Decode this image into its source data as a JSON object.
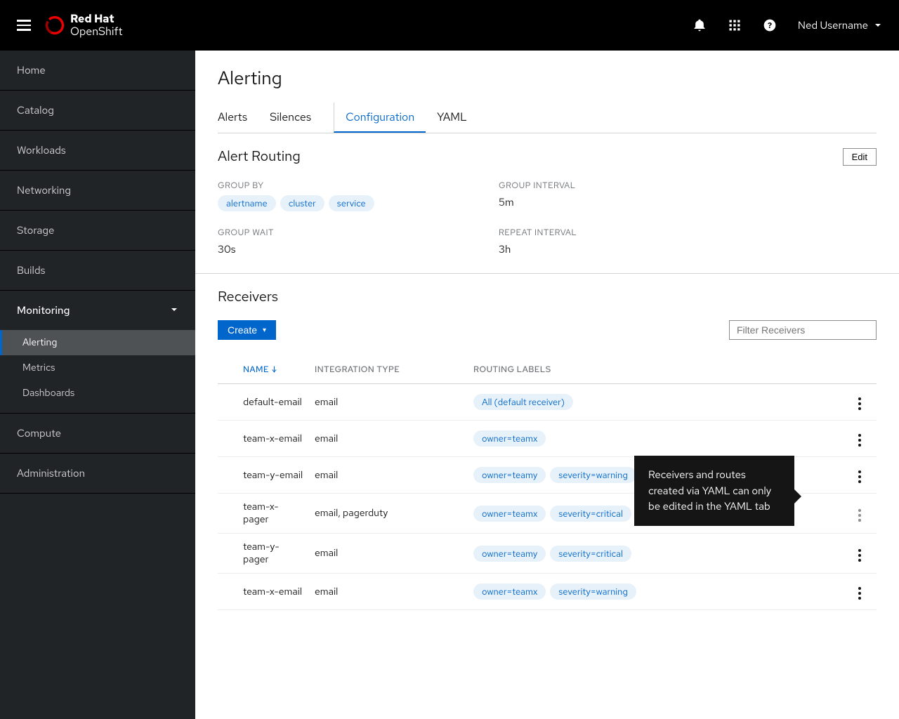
{
  "brand": {
    "line1": "Red Hat",
    "line2": "OpenShift"
  },
  "user": {
    "name": "Ned Username"
  },
  "sidebar": {
    "items": [
      {
        "label": "Home"
      },
      {
        "label": "Catalog"
      },
      {
        "label": "Workloads"
      },
      {
        "label": "Networking"
      },
      {
        "label": "Storage"
      },
      {
        "label": "Builds"
      },
      {
        "label": "Monitoring",
        "expanded": true,
        "children": [
          {
            "label": "Alerting",
            "active": true
          },
          {
            "label": "Metrics"
          },
          {
            "label": "Dashboards"
          }
        ]
      },
      {
        "label": "Compute"
      },
      {
        "label": "Administration"
      }
    ]
  },
  "page": {
    "title": "Alerting",
    "tabs": [
      {
        "label": "Alerts"
      },
      {
        "label": "Silences"
      },
      {
        "label": "Configuration",
        "active": true,
        "sep": true
      },
      {
        "label": "YAML"
      }
    ]
  },
  "routing": {
    "title": "Alert Routing",
    "edit_label": "Edit",
    "group_by_label": "GROUP BY",
    "group_by_chips": [
      "alertname",
      "cluster",
      "service"
    ],
    "group_interval_label": "GROUP INTERVAL",
    "group_interval_value": "5m",
    "group_wait_label": "GROUP WAIT",
    "group_wait_value": "30s",
    "repeat_interval_label": "REPEAT INTERVAL",
    "repeat_interval_value": "3h"
  },
  "receivers": {
    "title": "Receivers",
    "create_label": "Create",
    "filter_placeholder": "Filter Receivers",
    "columns": {
      "name": "NAME",
      "integration": "INTEGRATION TYPE",
      "labels": "ROUTING LABELS"
    },
    "rows": [
      {
        "name": "default-email",
        "integration": "email",
        "labels": [
          "All (default receiver)"
        ]
      },
      {
        "name": "team-x-email",
        "integration": "email",
        "labels": [
          "owner=teamx"
        ]
      },
      {
        "name": "team-y-email",
        "integration": "email",
        "labels": [
          "owner=teamy",
          "severity=warning"
        ]
      },
      {
        "name": "team-x-pager",
        "integration": "email, pagerduty",
        "labels": [
          "owner=teamx",
          "severity=critical"
        ],
        "kebab_disabled": true
      },
      {
        "name": "team-y-pager",
        "integration": "email",
        "labels": [
          "owner=teamy",
          "severity=critical"
        ]
      },
      {
        "name": "team-x-email",
        "integration": "email",
        "labels": [
          "owner=teamx",
          "severity=warning"
        ]
      }
    ]
  },
  "tooltip": {
    "text": "Receivers and routes created via YAML can only be edited in the YAML tab"
  }
}
